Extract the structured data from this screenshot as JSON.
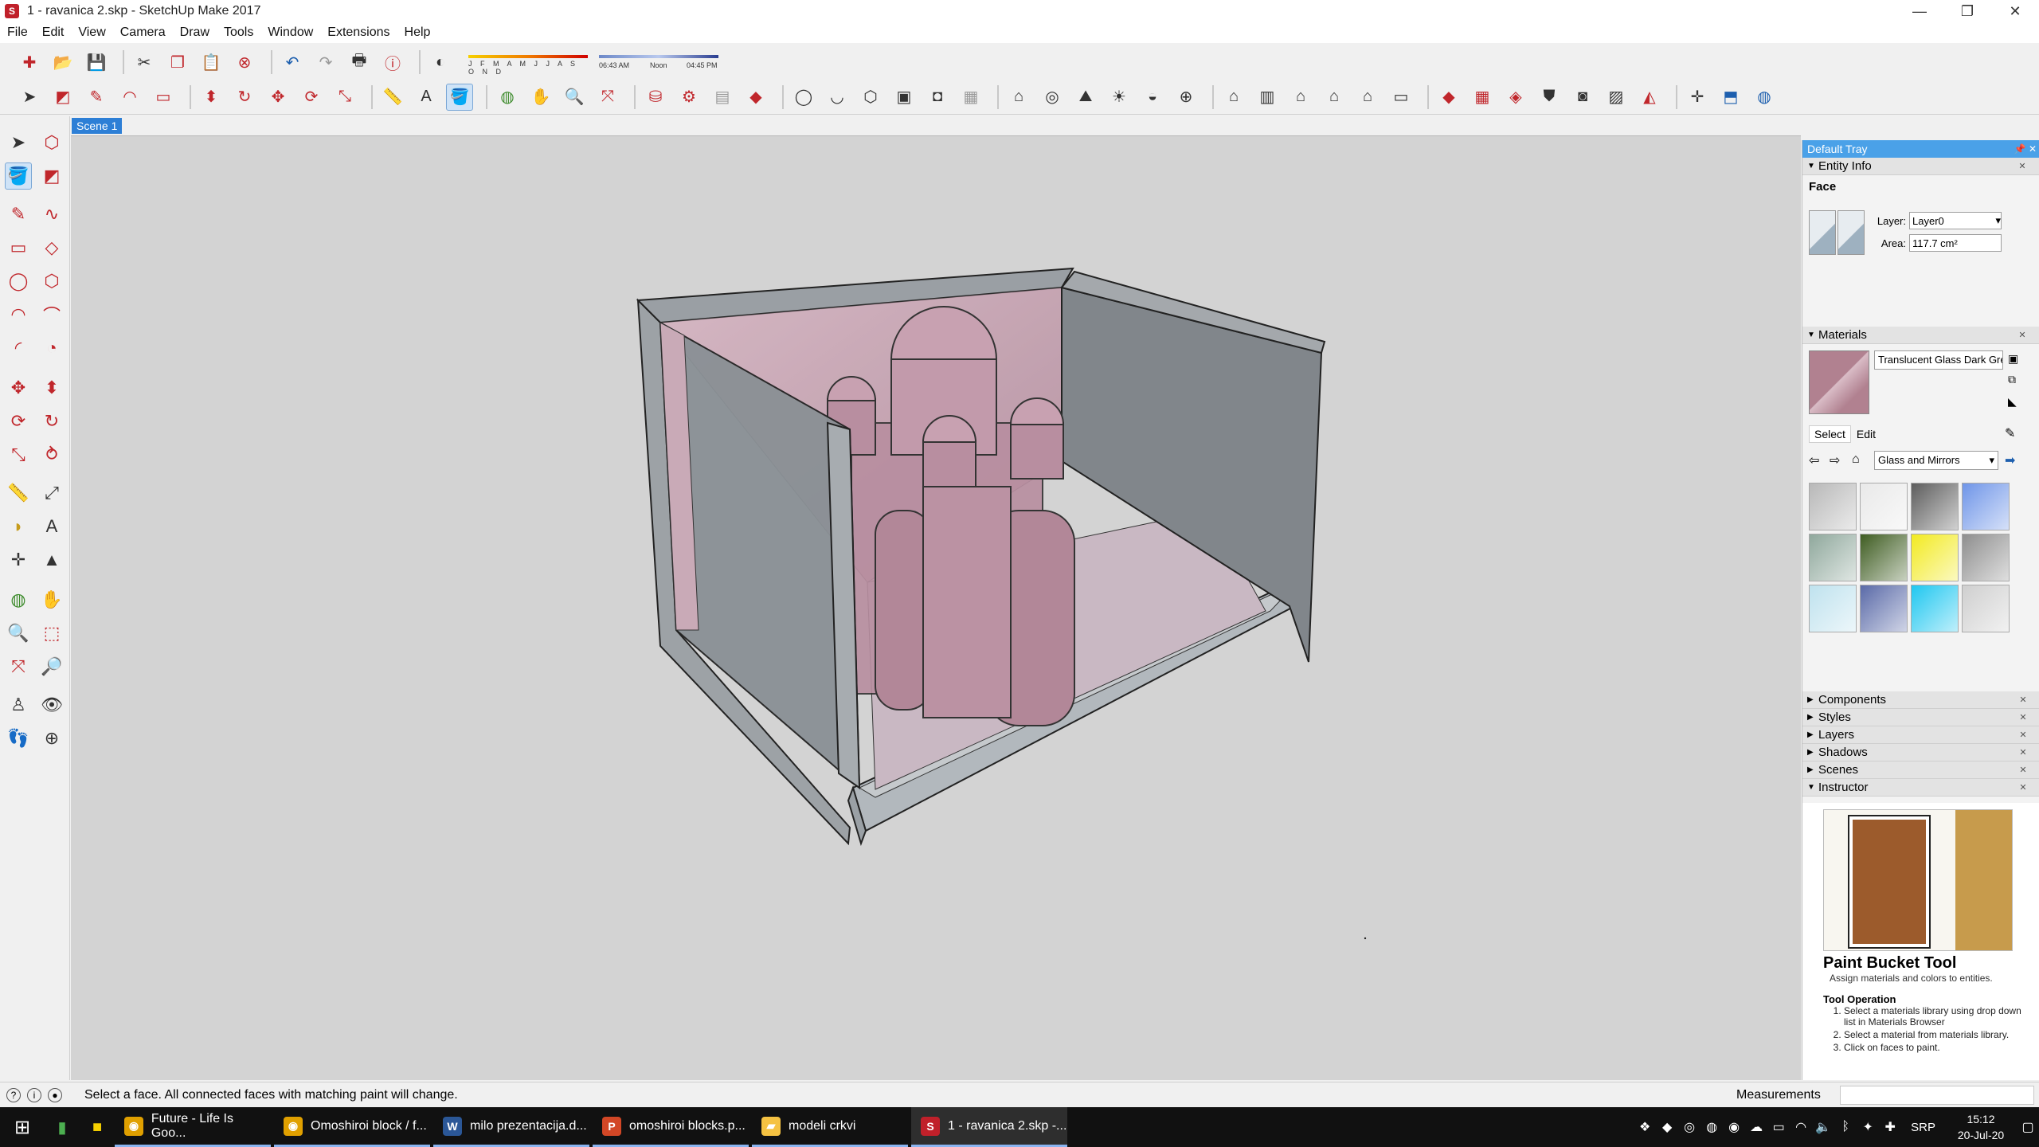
{
  "window": {
    "title": "1 - ravanica 2.skp - SketchUp Make 2017",
    "controls": [
      "—",
      "❐",
      "✕"
    ]
  },
  "menu": [
    "File",
    "Edit",
    "View",
    "Camera",
    "Draw",
    "Tools",
    "Window",
    "Extensions",
    "Help"
  ],
  "shadow": {
    "months": "J F M A M J J A S O N D",
    "time_start": "06:43 AM",
    "time_mid": "Noon",
    "time_end": "04:45 PM"
  },
  "scene_tab": "Scene 1",
  "tray": {
    "title": "Default Tray",
    "entity_info": {
      "heading": "Entity Info",
      "type": "Face",
      "layer_label": "Layer:",
      "layer_value": "Layer0",
      "area_label": "Area:",
      "area_value": "117.7 cm²"
    },
    "materials": {
      "heading": "Materials",
      "name": "Translucent Glass Dark Gre",
      "tab_select": "Select",
      "tab_edit": "Edit",
      "library": "Glass and Mirrors",
      "swatch_colors": [
        "#b8b8b8",
        "#e9e9e9",
        "#5d5d5d",
        "#6f95e8",
        "#8fa89c",
        "#3f5d22",
        "#f2ea21",
        "#8e8e8e",
        "#bfe2ee",
        "#5a6aa8",
        "#1fc7f0",
        "#cfcfcf"
      ]
    },
    "panels": [
      "Components",
      "Styles",
      "Layers",
      "Shadows",
      "Scenes",
      "Instructor"
    ],
    "instructor": {
      "title": "Paint Bucket Tool",
      "subtitle": "Assign materials and colors to entities.",
      "section": "Tool Operation",
      "steps": [
        "Select a materials library using drop down list in Materials Browser",
        "Select a material from materials library.",
        "Click on faces to paint."
      ]
    }
  },
  "status": {
    "message": "Select a face.  All connected faces with matching paint will change.",
    "measurements_label": "Measurements"
  },
  "taskbar": {
    "tasks": [
      {
        "label": "Future - Life Is Goo...",
        "icon": "chrome-icon"
      },
      {
        "label": "Omoshiroi block / f...",
        "icon": "chrome-icon"
      },
      {
        "label": "milo prezentacija.d...",
        "icon": "word-icon"
      },
      {
        "label": "omoshiroi blocks.p...",
        "icon": "powerpoint-icon"
      },
      {
        "label": "modeli crkvi",
        "icon": "folder-icon"
      },
      {
        "label": "1 - ravanica 2.skp -...",
        "icon": "sketchup-icon"
      }
    ],
    "language": "SRP",
    "time": "15:12",
    "date": "20-Jul-20"
  }
}
